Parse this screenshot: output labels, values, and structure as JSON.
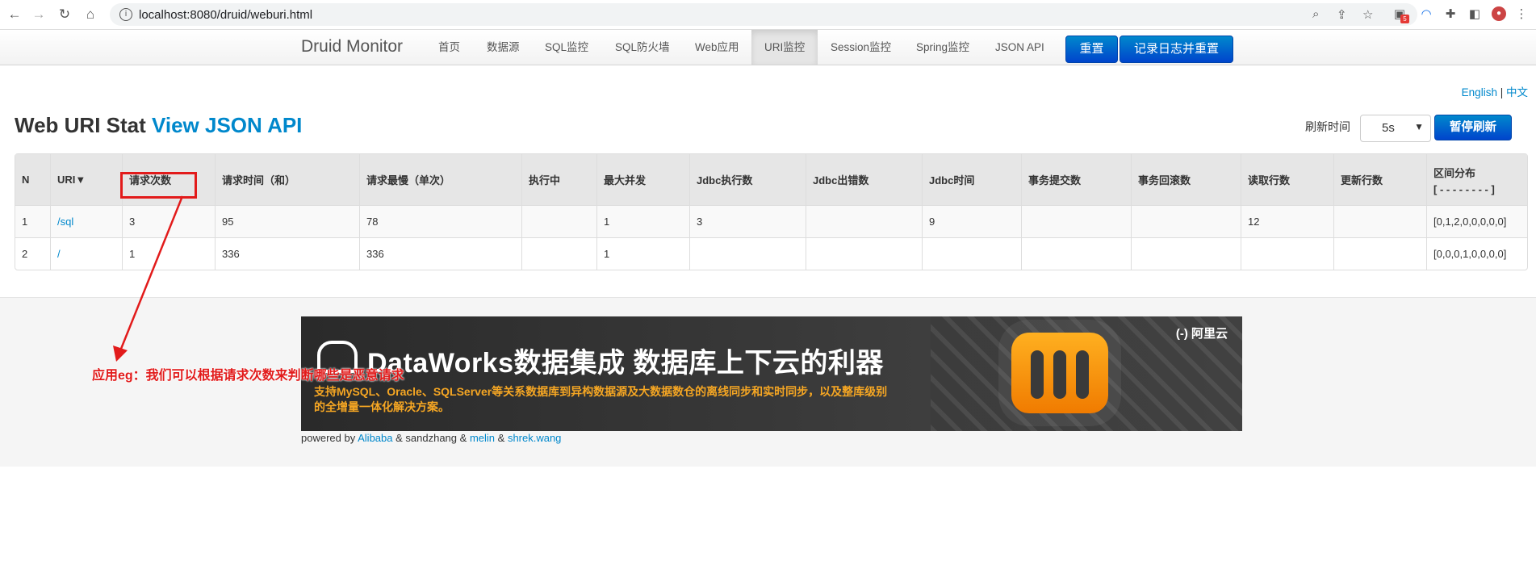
{
  "browser": {
    "url": "localhost:8080/druid/weburi.html",
    "ext_badge": "5"
  },
  "navbar": {
    "brand": "Druid Monitor",
    "items": [
      "首页",
      "数据源",
      "SQL监控",
      "SQL防火墙",
      "Web应用",
      "URI监控",
      "Session监控",
      "Spring监控",
      "JSON API"
    ],
    "active": "URI监控",
    "reset_label": "重置",
    "log_reset_label": "记录日志并重置"
  },
  "lang": {
    "english": "English",
    "sep": "|",
    "chinese": "中文"
  },
  "page": {
    "title": "Web URI Stat",
    "json_api": "View JSON API",
    "refresh_label": "刷新时间",
    "refresh_value": "5s",
    "pause_label": "暂停刷新"
  },
  "table": {
    "headers": [
      "N",
      "URI▼",
      "请求次数",
      "请求时间（和）",
      "请求最慢（单次）",
      "执行中",
      "最大并发",
      "Jdbc执行数",
      "Jdbc出错数",
      "Jdbc时间",
      "事务提交数",
      "事务回滚数",
      "读取行数",
      "更新行数"
    ],
    "dist_header": "区间分布",
    "dist_header_sub": "[ - - - - - - - - ]",
    "rows": [
      [
        "1",
        "/sql",
        "3",
        "95",
        "78",
        "",
        "1",
        "3",
        "",
        "9",
        "",
        "",
        "12",
        "",
        "[0,1,2,0,0,0,0,0]"
      ],
      [
        "2",
        "/",
        "1",
        "336",
        "336",
        "",
        "1",
        "",
        "",
        "",
        "",
        "",
        "",
        "",
        "[0,0,0,1,0,0,0,0]"
      ]
    ]
  },
  "banner": {
    "title": "DataWorks数据集成 数据库上下云的利器",
    "subtitle": "支持MySQL、Oracle、SQLServer等关系数据库到异构数据源及大数据数仓的离线同步和实时同步，以及整库级别的全增量一体化解决方案。",
    "brand": "(-) 阿里云"
  },
  "footer": {
    "powered_prefix": "powered by",
    "alibaba": "Alibaba",
    "amp1": "& sandzhang &",
    "melin": "melin",
    "amp2": "&",
    "shrek": "shrek.wang"
  },
  "annotation": {
    "text": "应用eg：我们可以根据请求次数来判断哪些是恶意请求",
    "color": "#e21b1b"
  }
}
